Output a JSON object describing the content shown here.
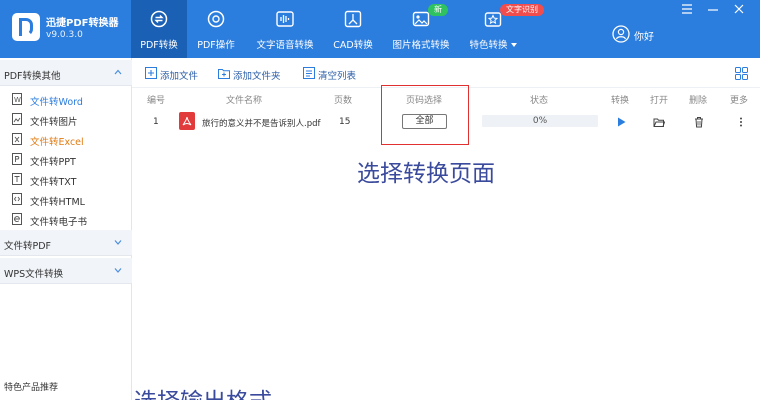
{
  "app": {
    "name": "迅捷PDF转换器",
    "version": "v9.0.3.0"
  },
  "nav": [
    {
      "label": "PDF转换",
      "icon": "convert-icon",
      "active": true
    },
    {
      "label": "PDF操作",
      "icon": "pdf-operate-icon",
      "active": false
    },
    {
      "label": "文字语音转换",
      "icon": "audio-wave-icon",
      "active": false
    },
    {
      "label": "CAD转换",
      "icon": "cad-icon",
      "active": false
    },
    {
      "label": "图片格式转换",
      "icon": "image-icon",
      "active": false
    },
    {
      "label": "特色转换",
      "icon": "feature-icon",
      "active": false
    }
  ],
  "badges": {
    "new": "新",
    "ocr": "文字识别"
  },
  "user": {
    "name": "你好"
  },
  "colors": {
    "primary": "#2b7dde",
    "active_nav": "#1a60b5",
    "highlight": "#e03030",
    "annotation": "#3a4a9c",
    "warn_text": "#e07b12"
  },
  "sidebar": {
    "group1": {
      "title": "PDF转换其他"
    },
    "items": [
      {
        "label": "文件转Word"
      },
      {
        "label": "文件转图片"
      },
      {
        "label": "文件转Excel"
      },
      {
        "label": "文件转PPT"
      },
      {
        "label": "文件转TXT"
      },
      {
        "label": "文件转HTML"
      },
      {
        "label": "文件转电子书"
      }
    ],
    "group2": {
      "title": "文件转PDF"
    },
    "group3": {
      "title": "WPS文件转换"
    },
    "footer": "特色产品推荐"
  },
  "toolbar": {
    "add_file": "添加文件",
    "add_folder": "添加文件夹",
    "clear_list": "清空列表"
  },
  "table": {
    "headers": {
      "index": "编号",
      "name": "文件名称",
      "pages": "页数",
      "page_select": "页码选择",
      "status": "状态",
      "convert": "转换",
      "open": "打开",
      "delete": "删除",
      "more": "更多"
    },
    "rows": [
      {
        "index": "1",
        "name": "旅行的意义并不是告诉别人.pdf",
        "pages": "15",
        "page_select": "全部",
        "progress_pct": "0%",
        "progress": 0
      }
    ]
  },
  "annotations": {
    "select_pages": "选择转换页面",
    "select_format": "选择输出格式"
  }
}
